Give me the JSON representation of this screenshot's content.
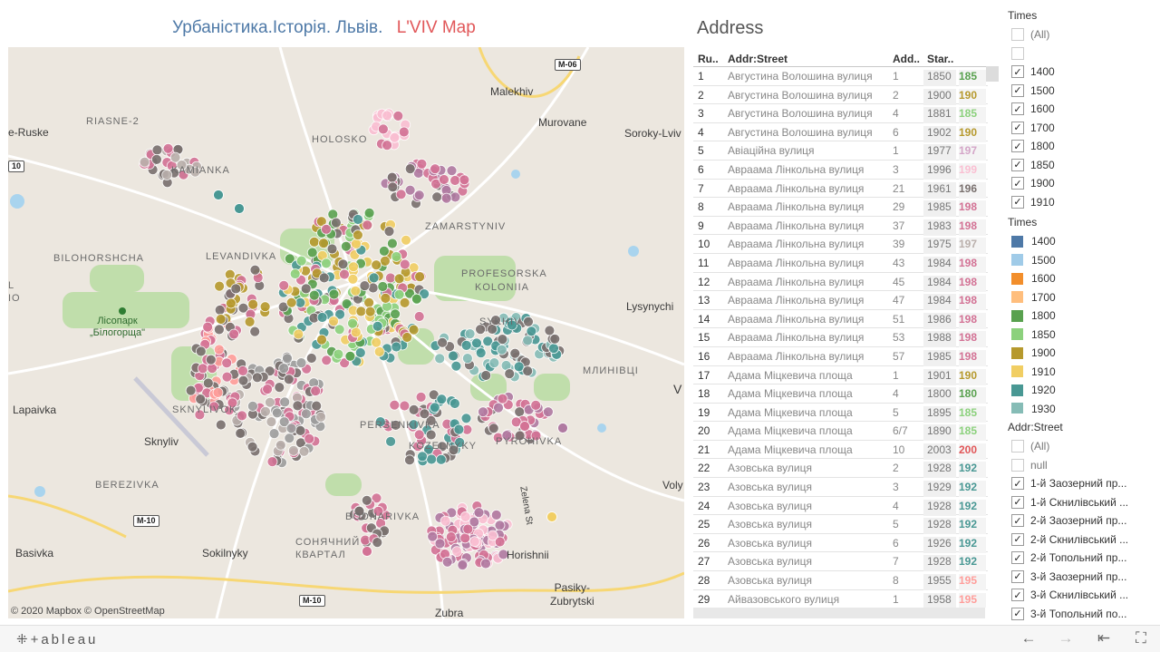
{
  "title": {
    "part1": "Урбаністика.Історія. Львів.",
    "part2": "L'VIV  Map"
  },
  "map": {
    "attribution": "© 2020 Mapbox  © OpenStreetMap",
    "labels": {
      "malekhiv": "Malekhiv",
      "murovane": "Murovane",
      "soroky": "Soroky-Lviv",
      "ruske": "e-Ruske",
      "riasne": "RIASNE-2",
      "holosko": "HOLOSKO",
      "kamianka": "KAMIANKA",
      "bilohorshcha": "BILOHORSHCHA",
      "levandivka": "LEVANDIVKA",
      "zamarstyniv": "ZAMARSTYNIV",
      "profesorska": "PROFESORSKA",
      "kolonia": "KOLONIIA",
      "lysynychi": "Lysynychi",
      "sykhiv": "SYKHIV",
      "mlynivtsi": "МЛИНІВЦІ",
      "lisopark": "Лісопарк\n„Білогорща\"",
      "lapaivka": "Lapaivka",
      "skniliv_district": "SKNYLIVOK",
      "skniliv": "Sknyliv",
      "persenkivka": "PERSENKIVKA",
      "kozelnyky": "KOZELNYKY",
      "pyrohivka": "PYROHIVKA",
      "berezivka": "BEREZIVKA",
      "bodnarivka": "BODNARIVKA",
      "sonyachnyi": "СОНЯЧНИЙ\nКВАРТАЛ",
      "basivka": "Basivka",
      "sokilnyky": "Sokilnyky",
      "horishnii": "Horishnii",
      "pasiky": "Pasiky-\nZubrytski",
      "zubra": "Zubra",
      "volya": "Voly",
      "vynnyky": "V",
      "zelena": "Zelena St",
      "lvi_l": "L",
      "lvi_io": "IO"
    },
    "shields": {
      "m06": "M-06",
      "m10a": "M-10",
      "m10b": "M-10",
      "m10c": "10"
    }
  },
  "address": {
    "title": "Address",
    "headers": {
      "num": "Ru..",
      "street": "Addr:Street",
      "addr": "Add..",
      "start": "Star.."
    },
    "rows": [
      {
        "num": "1",
        "street": "Августина Волошина вулиця",
        "addr": "1",
        "start": "1850",
        "time": "185",
        "color": "#59a14f"
      },
      {
        "num": "2",
        "street": "Августина Волошина вулиця",
        "addr": "2",
        "start": "1900",
        "time": "190",
        "color": "#b6992d"
      },
      {
        "num": "3",
        "street": "Августина Волошина вулиця",
        "addr": "4",
        "start": "1881",
        "time": "185",
        "color": "#8cd17d"
      },
      {
        "num": "4",
        "street": "Августина Волошина вулиця",
        "addr": "6",
        "start": "1902",
        "time": "190",
        "color": "#b6992d"
      },
      {
        "num": "5",
        "street": "Авіаційна вулиця",
        "addr": "1",
        "start": "1977",
        "time": "197",
        "color": "#d4a6c8"
      },
      {
        "num": "6",
        "street": "Авраама Лінкольна вулиця",
        "addr": "3",
        "start": "1996",
        "time": "199",
        "color": "#fabfd2"
      },
      {
        "num": "7",
        "street": "Авраама Лінкольна вулиця",
        "addr": "21",
        "start": "1961",
        "time": "196",
        "color": "#79706e"
      },
      {
        "num": "8",
        "street": "Авраама Лінкольна вулиця",
        "addr": "29",
        "start": "1985",
        "time": "198",
        "color": "#d37295"
      },
      {
        "num": "9",
        "street": "Авраама Лінкольна вулиця",
        "addr": "37",
        "start": "1983",
        "time": "198",
        "color": "#d37295"
      },
      {
        "num": "10",
        "street": "Авраама Лінкольна вулиця",
        "addr": "39",
        "start": "1975",
        "time": "197",
        "color": "#bab0ac"
      },
      {
        "num": "11",
        "street": "Авраама Лінкольна вулиця",
        "addr": "43",
        "start": "1984",
        "time": "198",
        "color": "#d37295"
      },
      {
        "num": "12",
        "street": "Авраама Лінкольна вулиця",
        "addr": "45",
        "start": "1984",
        "time": "198",
        "color": "#d37295"
      },
      {
        "num": "13",
        "street": "Авраама Лінкольна вулиця",
        "addr": "47",
        "start": "1984",
        "time": "198",
        "color": "#d37295"
      },
      {
        "num": "14",
        "street": "Авраама Лінкольна вулиця",
        "addr": "51",
        "start": "1986",
        "time": "198",
        "color": "#d37295"
      },
      {
        "num": "15",
        "street": "Авраама Лінкольна вулиця",
        "addr": "53",
        "start": "1988",
        "time": "198",
        "color": "#d37295"
      },
      {
        "num": "16",
        "street": "Авраама Лінкольна вулиця",
        "addr": "57",
        "start": "1985",
        "time": "198",
        "color": "#d37295"
      },
      {
        "num": "17",
        "street": "Адама Міцкевича площа",
        "addr": "1",
        "start": "1901",
        "time": "190",
        "color": "#b6992d"
      },
      {
        "num": "18",
        "street": "Адама Міцкевича площа",
        "addr": "4",
        "start": "1800",
        "time": "180",
        "color": "#59a14f"
      },
      {
        "num": "19",
        "street": "Адама Міцкевича площа",
        "addr": "5",
        "start": "1895",
        "time": "185",
        "color": "#8cd17d"
      },
      {
        "num": "20",
        "street": "Адама Міцкевича площа",
        "addr": "6/7",
        "start": "1890",
        "time": "185",
        "color": "#8cd17d"
      },
      {
        "num": "21",
        "street": "Адама Міцкевича площа",
        "addr": "10",
        "start": "2003",
        "time": "200",
        "color": "#e15759"
      },
      {
        "num": "22",
        "street": "Азовська вулиця",
        "addr": "2",
        "start": "1928",
        "time": "192",
        "color": "#499894"
      },
      {
        "num": "23",
        "street": "Азовська вулиця",
        "addr": "3",
        "start": "1929",
        "time": "192",
        "color": "#499894"
      },
      {
        "num": "24",
        "street": "Азовська вулиця",
        "addr": "4",
        "start": "1928",
        "time": "192",
        "color": "#499894"
      },
      {
        "num": "25",
        "street": "Азовська вулиця",
        "addr": "5",
        "start": "1928",
        "time": "192",
        "color": "#499894"
      },
      {
        "num": "26",
        "street": "Азовська вулиця",
        "addr": "6",
        "start": "1926",
        "time": "192",
        "color": "#499894"
      },
      {
        "num": "27",
        "street": "Азовська вулиця",
        "addr": "7",
        "start": "1928",
        "time": "192",
        "color": "#499894"
      },
      {
        "num": "28",
        "street": "Азовська вулиця",
        "addr": "8",
        "start": "1955",
        "time": "195",
        "color": "#ff9d9a"
      },
      {
        "num": "29",
        "street": "Айвазовського вулиця",
        "addr": "1",
        "start": "1958",
        "time": "195",
        "color": "#ff9d9a"
      }
    ]
  },
  "times_filter": {
    "label": "Times",
    "items": [
      {
        "label": "(All)",
        "checked": false
      },
      {
        "label": "",
        "checked": false
      },
      {
        "label": "1400",
        "checked": true
      },
      {
        "label": "1500",
        "checked": true
      },
      {
        "label": "1600",
        "checked": true
      },
      {
        "label": "1700",
        "checked": true
      },
      {
        "label": "1800",
        "checked": true
      },
      {
        "label": "1850",
        "checked": true
      },
      {
        "label": "1900",
        "checked": true
      },
      {
        "label": "1910",
        "checked": true
      }
    ]
  },
  "times_legend": {
    "label": "Times",
    "items": [
      {
        "label": "1400",
        "color": "#4e79a7"
      },
      {
        "label": "1500",
        "color": "#a0cbe8"
      },
      {
        "label": "1600",
        "color": "#f28e2b"
      },
      {
        "label": "1700",
        "color": "#ffbe7d"
      },
      {
        "label": "1800",
        "color": "#59a14f"
      },
      {
        "label": "1850",
        "color": "#8cd17d"
      },
      {
        "label": "1900",
        "color": "#b6992d"
      },
      {
        "label": "1910",
        "color": "#f1ce63"
      },
      {
        "label": "1920",
        "color": "#499894"
      },
      {
        "label": "1930",
        "color": "#86bcb6"
      }
    ]
  },
  "street_filter": {
    "label": "Addr:Street",
    "items": [
      {
        "label": "(All)",
        "checked": false
      },
      {
        "label": "null",
        "checked": false
      },
      {
        "label": "1-й Заозерний пр...",
        "checked": true
      },
      {
        "label": "1-й Скнилівський ...",
        "checked": true
      },
      {
        "label": "2-й Заозерний пр...",
        "checked": true
      },
      {
        "label": "2-й Скнилівський ...",
        "checked": true
      },
      {
        "label": "2-й Топольний пр...",
        "checked": true
      },
      {
        "label": "3-й Заозерний пр...",
        "checked": true
      },
      {
        "label": "3-й Скнилівський ...",
        "checked": true
      },
      {
        "label": "3-й Топольний по...",
        "checked": true
      }
    ]
  },
  "footer": {
    "logo": "⁜+ableau"
  },
  "colors": {
    "title_blue": "#4e79a7",
    "title_red": "#e15759",
    "map_bg": "#ece7df",
    "park": "#b8dca2",
    "water": "#a9d4ee",
    "road": "#ffffff",
    "highway": "#f7d774"
  }
}
